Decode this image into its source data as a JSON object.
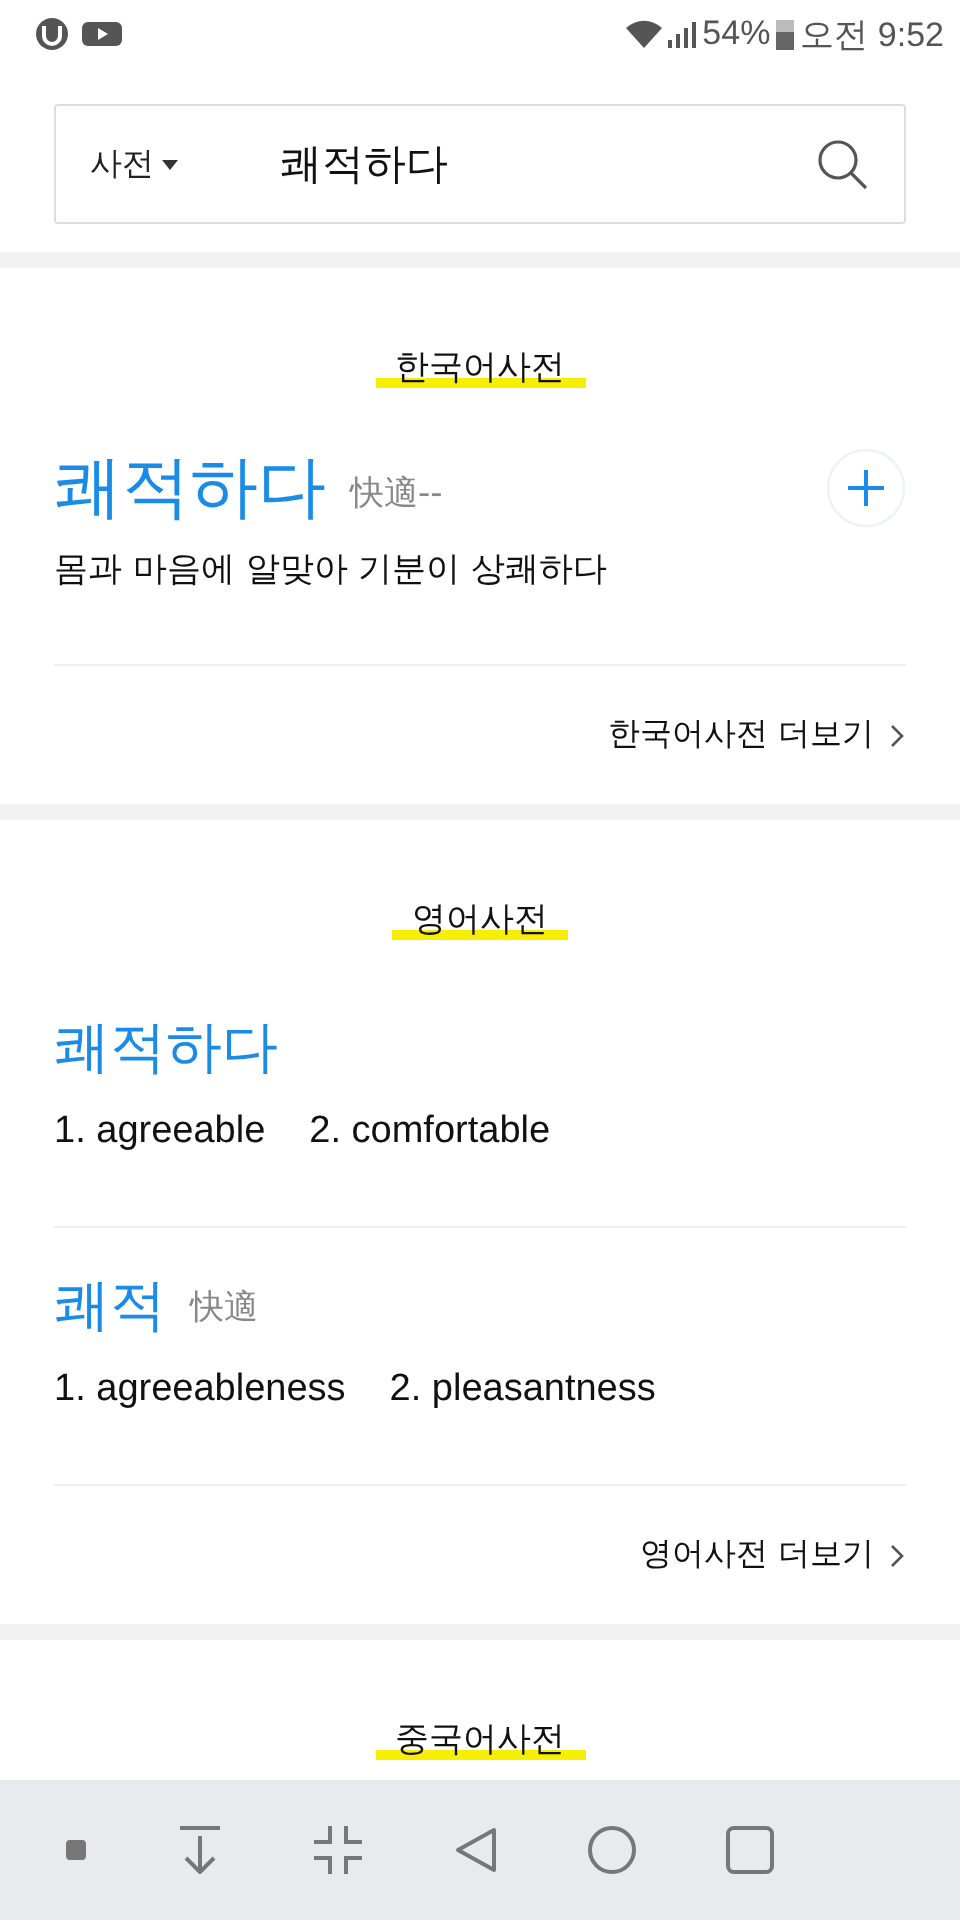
{
  "status_bar": {
    "battery": "54%",
    "time": "오전 9:52"
  },
  "search": {
    "scope": "사전",
    "query": "쾌적하다"
  },
  "sections": [
    {
      "title": "한국어사전",
      "entries": [
        {
          "kind": "definition",
          "word": "쾌적하다",
          "hanja": "快適--",
          "definition": "몸과 마음에 알맞아 기분이 상쾌하다"
        }
      ],
      "more": "한국어사전 더보기"
    },
    {
      "title": "영어사전",
      "entries": [
        {
          "kind": "meanings",
          "word": "쾌적하다",
          "meanings": [
            "1. agreeable",
            "2. comfortable"
          ]
        },
        {
          "kind": "meanings",
          "word": "쾌적",
          "hanja": "快適",
          "meanings": [
            "1. agreeableness",
            "2. pleasantness"
          ]
        }
      ],
      "more": "영어사전 더보기"
    },
    {
      "title": "중국어사전"
    }
  ]
}
